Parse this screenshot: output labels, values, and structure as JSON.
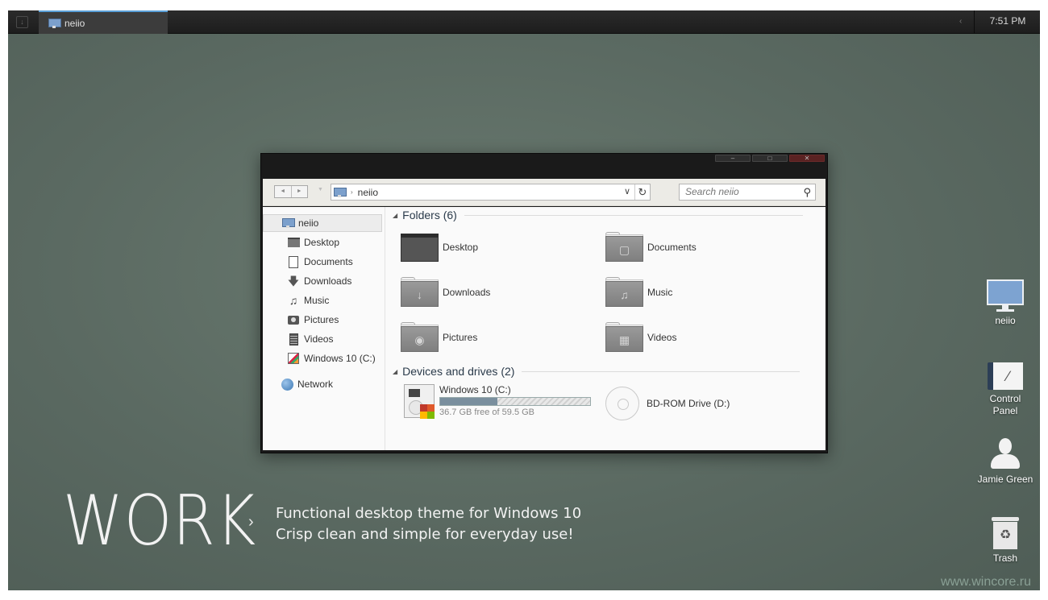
{
  "taskbar": {
    "start_symbol": "↓",
    "task_label": "neiio",
    "tray_arrow": "‹",
    "clock": "7:51 PM"
  },
  "explorer": {
    "controls": {
      "minimize": "–",
      "maximize": "□",
      "close": "✕"
    },
    "nav": {
      "back": "◄",
      "forward": "►",
      "recent": "▼"
    },
    "address": {
      "separator": "›",
      "location": "neiio",
      "dropdown": "∨",
      "refresh": "↻"
    },
    "search": {
      "placeholder": "Search neiio",
      "icon": "search-icon"
    },
    "navpane": {
      "root": "neiio",
      "items": [
        {
          "label": "Desktop",
          "icon": "desktop-icon"
        },
        {
          "label": "Documents",
          "icon": "document-icon"
        },
        {
          "label": "Downloads",
          "icon": "download-icon"
        },
        {
          "label": "Music",
          "icon": "music-icon"
        },
        {
          "label": "Pictures",
          "icon": "pictures-icon"
        },
        {
          "label": "Videos",
          "icon": "videos-icon"
        },
        {
          "label": "Windows 10 (C:)",
          "icon": "drive-icon"
        }
      ],
      "network": "Network"
    },
    "folders_header": "Folders (6)",
    "folders": [
      {
        "label": "Desktop",
        "icon": "desktop-folder-icon"
      },
      {
        "label": "Documents",
        "icon": "documents-folder-icon"
      },
      {
        "label": "Downloads",
        "icon": "downloads-folder-icon"
      },
      {
        "label": "Music",
        "icon": "music-folder-icon"
      },
      {
        "label": "Pictures",
        "icon": "pictures-folder-icon"
      },
      {
        "label": "Videos",
        "icon": "videos-folder-icon"
      }
    ],
    "devices_header": "Devices and drives (2)",
    "drives": {
      "c": {
        "name": "Windows 10 (C:)",
        "free": "36.7 GB free of 59.5 GB",
        "used_fraction": 0.38
      },
      "d": {
        "name": "BD-ROM Drive (D:)"
      }
    }
  },
  "desktop": {
    "icons": [
      {
        "label": "neiio",
        "icon": "computer-icon"
      },
      {
        "label": "Control Panel",
        "icon": "control-panel-icon"
      },
      {
        "label": "Jamie Green",
        "icon": "user-icon"
      },
      {
        "label": "Trash",
        "icon": "trash-icon"
      }
    ],
    "tagline": {
      "big": "WORK",
      "arrow": "›",
      "line1": "Functional desktop theme for Windows 10",
      "line2": "Crisp clean and simple for everyday use!"
    },
    "watermark": "www.wincore.ru"
  },
  "colors": {
    "desktop_bg": "#5a6961",
    "taskbar_bg": "#222222",
    "active_task_accent": "#5aa0d8",
    "window_frame": "#1a1a1a",
    "window_bg": "#fafafa",
    "close_button": "#5a2222"
  }
}
